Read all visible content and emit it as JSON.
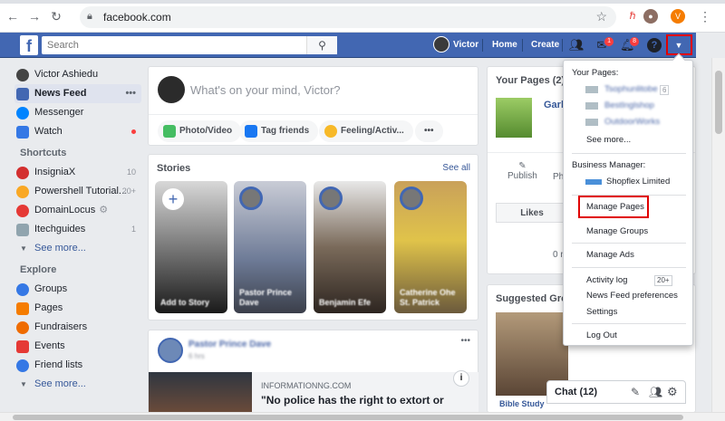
{
  "browser": {
    "url": "facebook.com",
    "profile_initial": "V"
  },
  "fb": {
    "logo": "f",
    "search_placeholder": "Search",
    "user_name": "Victor",
    "nav_home": "Home",
    "nav_create": "Create",
    "messages_count": "1",
    "notifications_count": "8",
    "help": "?"
  },
  "sidebar": {
    "profile": "Victor Ashiedu",
    "main": [
      {
        "label": "News Feed"
      },
      {
        "label": "Messenger"
      },
      {
        "label": "Watch"
      }
    ],
    "shortcuts_title": "Shortcuts",
    "shortcuts": [
      {
        "label": "InsigniaX",
        "count": "10"
      },
      {
        "label": "Powershell Tutorial...",
        "count": "20+"
      },
      {
        "label": "DomainLocus",
        "count": ""
      },
      {
        "label": "Itechguides",
        "count": "1"
      }
    ],
    "see_more_1": "See more...",
    "explore_title": "Explore",
    "explore": [
      {
        "label": "Groups"
      },
      {
        "label": "Pages"
      },
      {
        "label": "Fundraisers"
      },
      {
        "label": "Events"
      },
      {
        "label": "Friend lists"
      }
    ],
    "see_more_2": "See more..."
  },
  "composer": {
    "placeholder": "What's on your mind, Victor?",
    "photo": "Photo/Video",
    "tag": "Tag friends",
    "feeling": "Feeling/Activ...",
    "more": "•••"
  },
  "stories": {
    "title": "Stories",
    "see_all": "See all",
    "items": [
      {
        "name": "Add to Story"
      },
      {
        "name": "Pastor Prince Dave"
      },
      {
        "name": "Benjamin Efe"
      },
      {
        "name": "Catherine Ohe St. Patrick"
      }
    ]
  },
  "post": {
    "author": "Pastor Prince Dave",
    "time": "6 hrs",
    "source": "INFORMATIONNG.COM",
    "headline": "\"No police has the right to extort or"
  },
  "right": {
    "your_pages": "Your Pages (2)",
    "page_name": "Garl",
    "publish": "Publish",
    "photo": "Ph",
    "likes": "Likes",
    "zero": "0 n",
    "suggested": "Suggested Group",
    "bible_study": "Bible Study"
  },
  "chat": {
    "label": "Chat (12)"
  },
  "dropdown": {
    "your_pages_header": "Your Pages:",
    "pages": [
      {
        "name": "Tsophunlitobe",
        "count": "6"
      },
      {
        "name": "BestInglshop",
        "count": ""
      },
      {
        "name": "OutdoorWorks",
        "count": ""
      }
    ],
    "see_more": "See more...",
    "bm_header": "Business Manager:",
    "bm_name": "Shopflex Limited",
    "manage_pages": "Manage Pages",
    "manage_groups": "Manage Groups",
    "manage_ads": "Manage Ads",
    "activity_log": "Activity log",
    "activity_count": "20+",
    "news_feed_prefs": "News Feed preferences",
    "settings": "Settings",
    "logout": "Log Out"
  },
  "colors": {
    "fb_blue": "#4267b2",
    "highlight": "#e00000",
    "notif_red": "#fa3e3e"
  }
}
